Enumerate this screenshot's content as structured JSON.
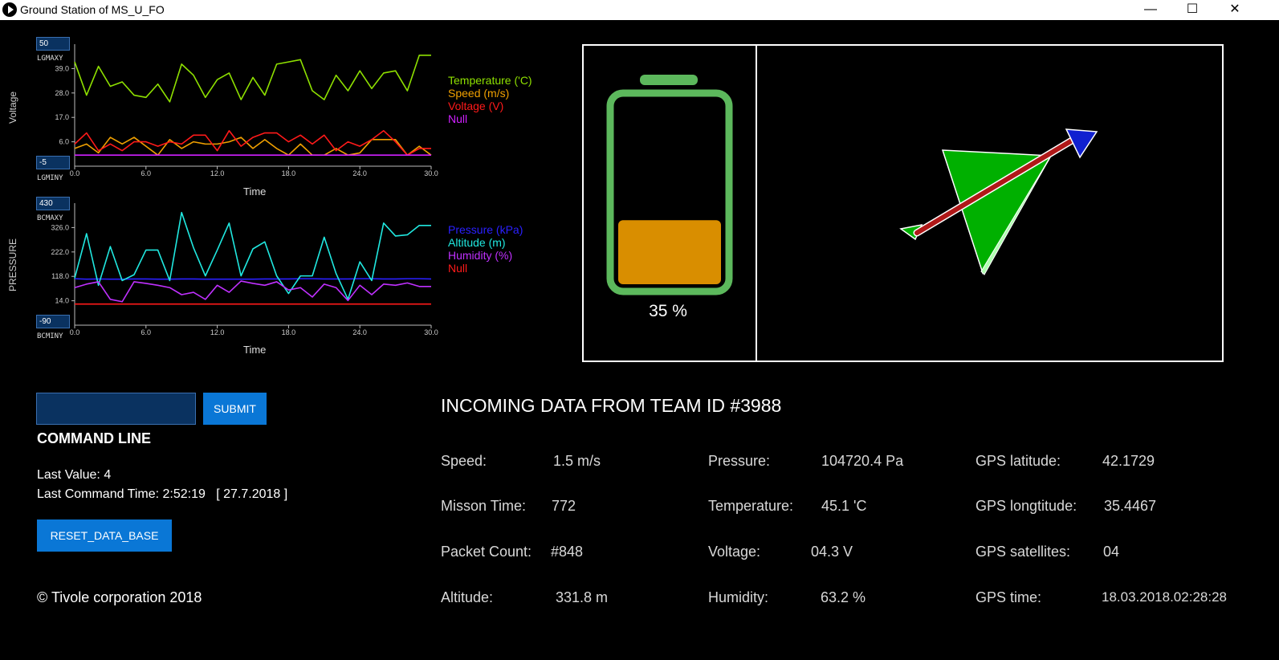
{
  "window": {
    "title": "Ground Station of MS_U_FO",
    "minimize": "—",
    "maximize": "☐",
    "close": "✕"
  },
  "charts": {
    "top": {
      "y_axis_title": "Voltage",
      "x_axis_title": "Time",
      "max_box": "50",
      "min_box": "-5",
      "max_label": "LGMAXY",
      "min_label": "LGMINY"
    },
    "bottom": {
      "y_axis_title": "PRESSURE",
      "x_axis_title": "Time",
      "max_box": "430",
      "min_box": "-90",
      "max_label": "BCMAXY",
      "min_label": "BCMINY"
    }
  },
  "chart_data": [
    {
      "type": "line",
      "xlabel": "Time",
      "ylabel": "Voltage",
      "ylim": [
        -5,
        50
      ],
      "xlim": [
        0,
        30
      ],
      "y_ticks": [
        "6.0",
        "17.0",
        "28.0",
        "39.0"
      ],
      "x_ticks": [
        "0.0",
        "6.0",
        "12.0",
        "18.0",
        "24.0",
        "30.0"
      ],
      "x": [
        0,
        1,
        2,
        3,
        4,
        5,
        6,
        7,
        8,
        9,
        10,
        11,
        12,
        13,
        14,
        15,
        16,
        17,
        18,
        19,
        20,
        21,
        22,
        23,
        24,
        25,
        26,
        27,
        28,
        29,
        30
      ],
      "series": [
        {
          "name": "Temperature ('C)",
          "color": "#8ee000",
          "values": [
            42,
            27,
            40,
            31,
            33,
            27,
            26,
            32,
            24,
            41,
            36,
            26,
            34,
            37,
            25,
            35,
            27,
            41,
            42,
            43,
            29,
            25,
            36,
            29,
            38,
            30,
            37,
            38,
            29,
            45,
            45
          ]
        },
        {
          "name": "Speed (m/s)",
          "color": "#f0a000",
          "values": [
            3,
            5,
            1,
            8,
            5,
            8,
            4,
            0,
            7,
            3,
            6,
            5,
            5,
            6,
            8,
            3,
            7,
            3,
            0,
            5,
            0,
            0,
            3,
            0,
            1,
            7,
            7,
            7,
            0,
            4,
            0
          ]
        },
        {
          "name": "Voltage (V)",
          "color": "#ff1a1a",
          "values": [
            5,
            10,
            2,
            5,
            2,
            6,
            6,
            4,
            6,
            5,
            9,
            9,
            2,
            11,
            4,
            8,
            10,
            10,
            6,
            9,
            5,
            9,
            2,
            6,
            4,
            7,
            11,
            6,
            0,
            3,
            3
          ]
        },
        {
          "name": "Null",
          "color": "#d020ff",
          "values": [
            0,
            0,
            0,
            0,
            0,
            0,
            0,
            0,
            0,
            0,
            0,
            0,
            0,
            0,
            0,
            0,
            0,
            0,
            0,
            0,
            0,
            0,
            0,
            0,
            0,
            0,
            0,
            0,
            0,
            0,
            0
          ]
        }
      ]
    },
    {
      "type": "line",
      "xlabel": "Time",
      "ylabel": "PRESSURE",
      "ylim": [
        -90,
        430
      ],
      "xlim": [
        0,
        30
      ],
      "y_ticks": [
        "14.0",
        "118.0",
        "222.0",
        "326.0"
      ],
      "x_ticks": [
        "0.0",
        "6.0",
        "12.0",
        "18.0",
        "24.0",
        "30.0"
      ],
      "x": [
        0,
        1,
        2,
        3,
        4,
        5,
        6,
        7,
        8,
        9,
        10,
        11,
        12,
        13,
        14,
        15,
        16,
        17,
        18,
        19,
        20,
        21,
        22,
        23,
        24,
        25,
        26,
        27,
        28,
        29,
        30
      ],
      "series": [
        {
          "name": "Pressure (kPa)",
          "color": "#2a20ff",
          "values": [
            108,
            106,
            107,
            106,
            106,
            107,
            107,
            106,
            106,
            107,
            107,
            106,
            106,
            106,
            106,
            106,
            107,
            107,
            107,
            108,
            108,
            107,
            107,
            107,
            108,
            108,
            107,
            107,
            108,
            108,
            107
          ]
        },
        {
          "name": "Altitude (m)",
          "color": "#20e8e0",
          "values": [
            110,
            300,
            80,
            245,
            100,
            125,
            230,
            230,
            100,
            390,
            240,
            120,
            230,
            345,
            120,
            235,
            265,
            120,
            45,
            120,
            120,
            285,
            130,
            20,
            180,
            100,
            345,
            290,
            295,
            335,
            335
          ]
        },
        {
          "name": "Humidity (%)",
          "color": "#c030ff",
          "values": [
            70,
            85,
            95,
            20,
            10,
            95,
            88,
            80,
            70,
            40,
            50,
            20,
            80,
            50,
            98,
            88,
            80,
            95,
            60,
            70,
            30,
            85,
            70,
            15,
            80,
            40,
            85,
            80,
            90,
            75,
            75
          ]
        },
        {
          "name": "Null",
          "color": "#ff1a1a",
          "values": [
            0,
            0,
            0,
            0,
            0,
            0,
            0,
            0,
            0,
            0,
            0,
            0,
            0,
            0,
            0,
            0,
            0,
            0,
            0,
            0,
            0,
            0,
            0,
            0,
            0,
            0,
            0,
            0,
            0,
            0,
            0
          ]
        }
      ]
    }
  ],
  "battery": {
    "level": 0.35,
    "percent_text": "35 %",
    "frame_color": "#5cb85c",
    "fill_color": "#d98e00"
  },
  "attitude_icons": {
    "plane": "plane-icon",
    "arrow": "direction-arrow-icon"
  },
  "command": {
    "input_value": "",
    "input_placeholder": "",
    "submit_label": "SUBMIT",
    "section_label": "COMMAND LINE",
    "last_value": "Last Value: 4",
    "last_command_time": "Last Command Time: 2:52:19   [ 27.7.2018 ]",
    "reset_label": "RESET_DATA_BASE",
    "copyright": "© Tivole corporation 2018"
  },
  "incoming": {
    "title": "INCOMING DATA FROM TEAM ID #3988",
    "speed_label": "Speed:",
    "speed_value": "1.5 m/s",
    "mission_label": "Misson Time:",
    "mission_value": "772",
    "packet_label": "Packet Count:",
    "packet_value": "#848",
    "altitude_label": "Altitude:",
    "altitude_value": "331.8 m",
    "pressure_label": "Pressure:",
    "pressure_value": "104720.4 Pa",
    "temperature_label": "Temperature:",
    "temperature_value": "45.1 'C",
    "voltage_label": "Voltage:",
    "voltage_value": "04.3 V",
    "humidity_label": "Humidity:",
    "humidity_value": "63.2 %",
    "gps_lat_label": "GPS latitude:",
    "gps_lat_value": "42.1729",
    "gps_lon_label": "GPS longtitude:",
    "gps_lon_value": "35.4467",
    "gps_sat_label": "GPS satellites:",
    "gps_sat_value": "04",
    "gps_time_label": "GPS time:",
    "gps_time_value": "18.03.2018.02:28:28"
  }
}
